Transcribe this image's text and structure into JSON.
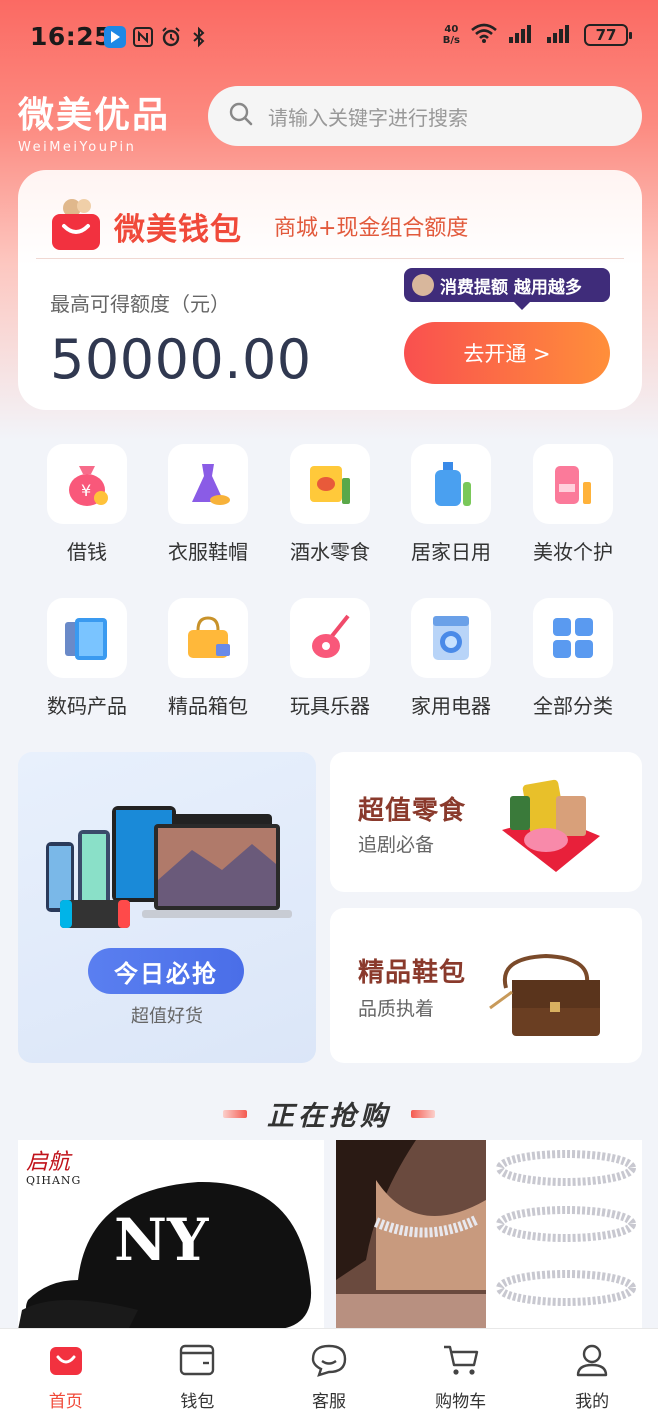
{
  "status_bar": {
    "time": "16:25",
    "net_speed_top": "40",
    "net_speed_unit": "B/s",
    "battery": "77"
  },
  "header": {
    "logo_cn": "微美优品",
    "logo_en": "WeiMeiYouPin",
    "search_placeholder": "请输入关键字进行搜索"
  },
  "wallet": {
    "title": "微美钱包",
    "subtitle": "商城+现金组合额度",
    "limit_label": "最高可得额度（元）",
    "amount": "50000.00",
    "promo_tag": "消费提额 越用越多",
    "open_button": "去开通 >"
  },
  "categories": [
    {
      "label": "借钱",
      "icon": "money-bag-icon"
    },
    {
      "label": "衣服鞋帽",
      "icon": "dress-icon"
    },
    {
      "label": "酒水零食",
      "icon": "snack-icon"
    },
    {
      "label": "居家日用",
      "icon": "detergent-icon"
    },
    {
      "label": "美妆个护",
      "icon": "cosmetics-icon"
    },
    {
      "label": "数码产品",
      "icon": "tablet-icon"
    },
    {
      "label": "精品箱包",
      "icon": "handbag-icon"
    },
    {
      "label": "玩具乐器",
      "icon": "guitar-icon"
    },
    {
      "label": "家用电器",
      "icon": "washing-machine-icon"
    },
    {
      "label": "全部分类",
      "icon": "grid-icon"
    }
  ],
  "promos": {
    "today": {
      "button": "今日必抢",
      "subtitle": "超值好货"
    },
    "snacks": {
      "title": "超值零食",
      "subtitle": "追剧必备"
    },
    "bags": {
      "title": "精品鞋包",
      "subtitle": "品质执着"
    }
  },
  "section": {
    "title": "正在抢购"
  },
  "products": [
    {
      "brand_cn": "启航",
      "brand_en": "QIHANG"
    }
  ],
  "tabbar": [
    {
      "label": "首页",
      "active": true
    },
    {
      "label": "钱包"
    },
    {
      "label": "客服"
    },
    {
      "label": "购物车"
    },
    {
      "label": "我的"
    }
  ],
  "colors": {
    "brand_red": "#f04a3a",
    "button_gradient_start": "#f9504f",
    "button_gradient_end": "#ff8f3a",
    "blue_button": "#5a7ff0"
  }
}
